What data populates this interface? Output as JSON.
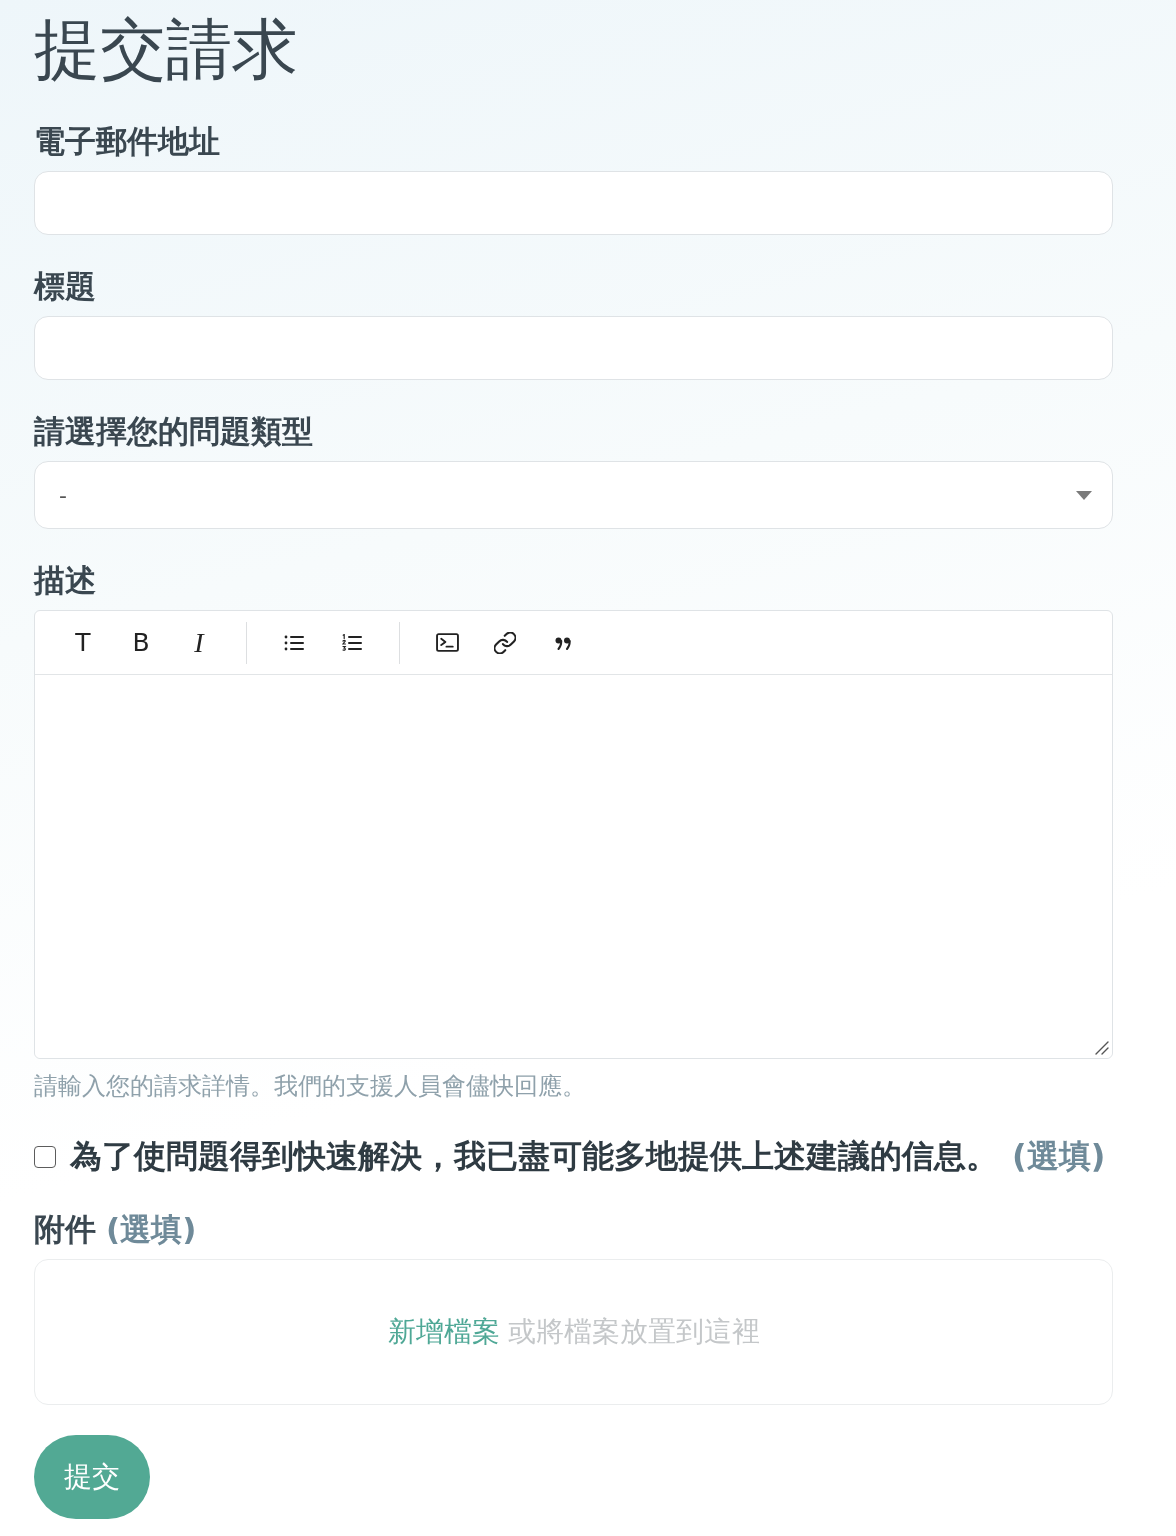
{
  "title": "提交請求",
  "fields": [
    {
      "kind": "text",
      "label": "電子郵件地址"
    },
    {
      "kind": "text",
      "label": "標題"
    },
    {
      "kind": "select",
      "label": "請選擇您的問題類型",
      "value": "-"
    },
    {
      "kind": "editor",
      "label": "描述",
      "toolbar": [
        {
          "tools": [
            {
              "kind": "heading",
              "glyph": "T"
            },
            {
              "kind": "bold",
              "glyph": "B"
            },
            {
              "kind": "italic",
              "glyph": "I"
            }
          ]
        },
        {
          "tools": [
            {
              "kind": "bullet-list"
            },
            {
              "kind": "numbered-list"
            }
          ]
        },
        {
          "tools": [
            {
              "kind": "code"
            },
            {
              "kind": "link"
            },
            {
              "kind": "quote"
            }
          ]
        }
      ],
      "hint": "請輸入您的請求詳情。我們的支援人員會儘快回應。"
    }
  ],
  "consent": {
    "checked": false,
    "label": "為了使問題得到快速解決，我已盡可能多地提供上述建議的信息。",
    "optional": "(選填)"
  },
  "attachments": {
    "label": "附件",
    "optional": "(選填)",
    "action": "新增檔案",
    "hint": "或將檔案放置到這裡"
  },
  "submit": "提交"
}
